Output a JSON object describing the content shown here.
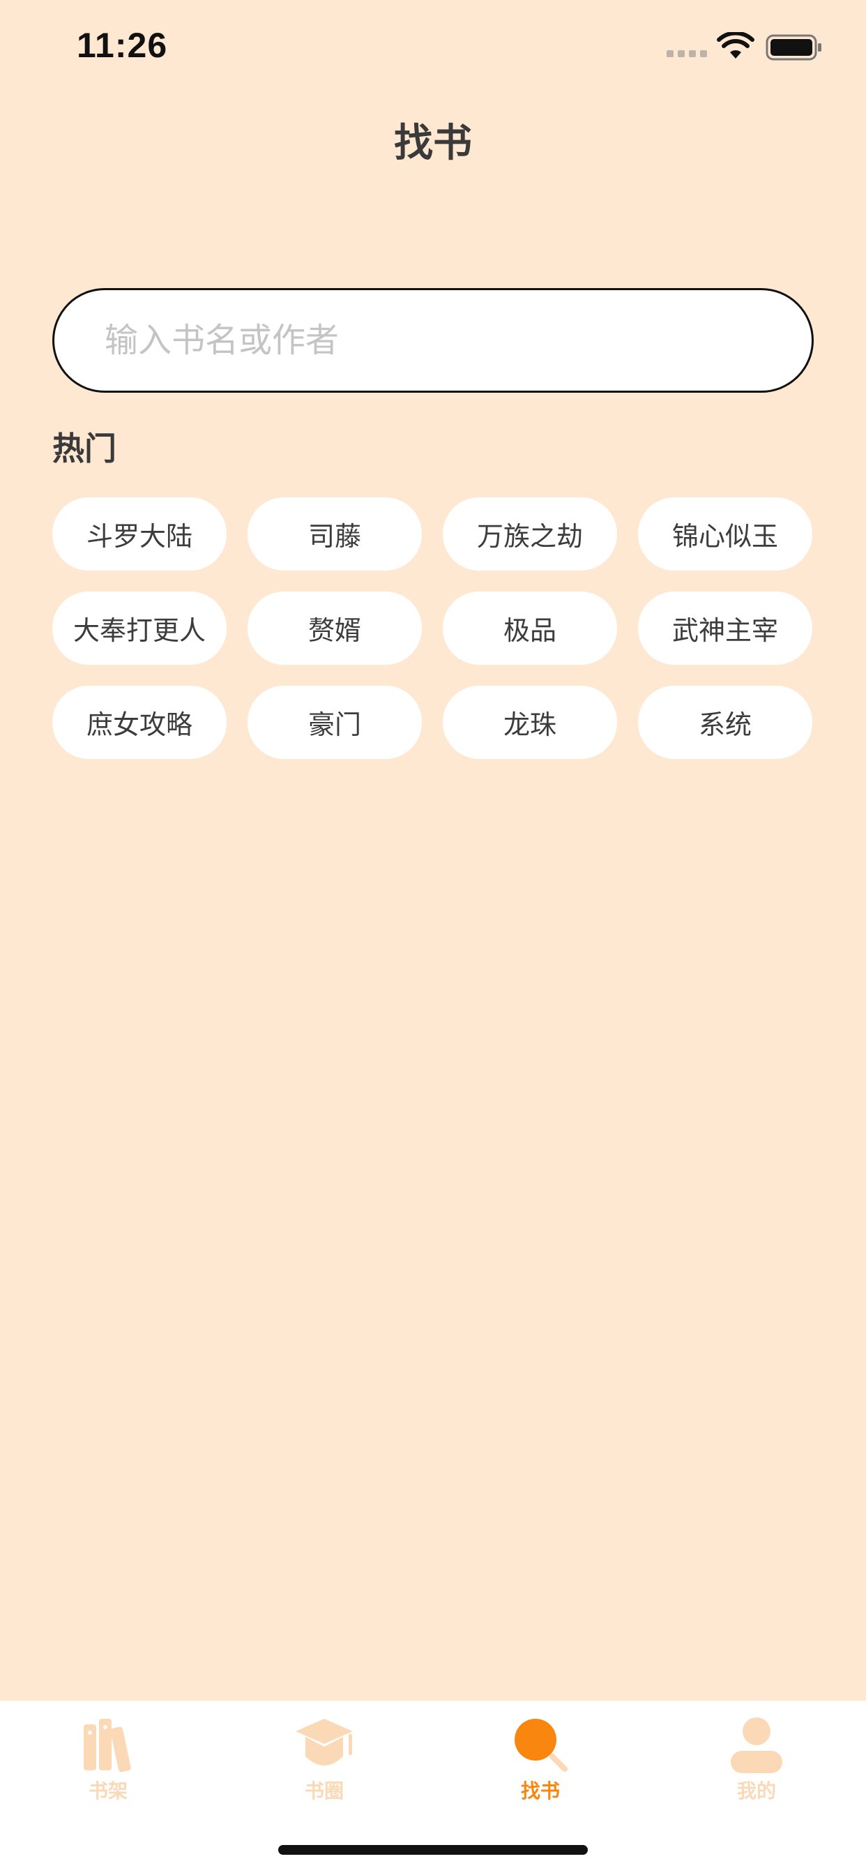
{
  "status_bar": {
    "time": "11:26"
  },
  "header": {
    "title": "找书"
  },
  "search": {
    "value": "",
    "placeholder": "输入书名或作者"
  },
  "hot": {
    "title": "热门",
    "tags": [
      "斗罗大陆",
      "司藤",
      "万族之劫",
      "锦心似玉",
      "大奉打更人",
      "赘婿",
      "极品",
      "武神主宰",
      "庶女攻略",
      "豪门",
      "龙珠",
      "系统"
    ]
  },
  "tab_bar": {
    "items": [
      {
        "label": "书架",
        "icon": "bookshelf-icon",
        "active": false
      },
      {
        "label": "书圈",
        "icon": "graduation-cap-icon",
        "active": false
      },
      {
        "label": "找书",
        "icon": "search-icon",
        "active": true
      },
      {
        "label": "我的",
        "icon": "profile-icon",
        "active": false
      }
    ]
  },
  "colors": {
    "background": "#FFE8D2",
    "accent": "#F8860F",
    "inactive_tab": "#FCD9B6"
  }
}
